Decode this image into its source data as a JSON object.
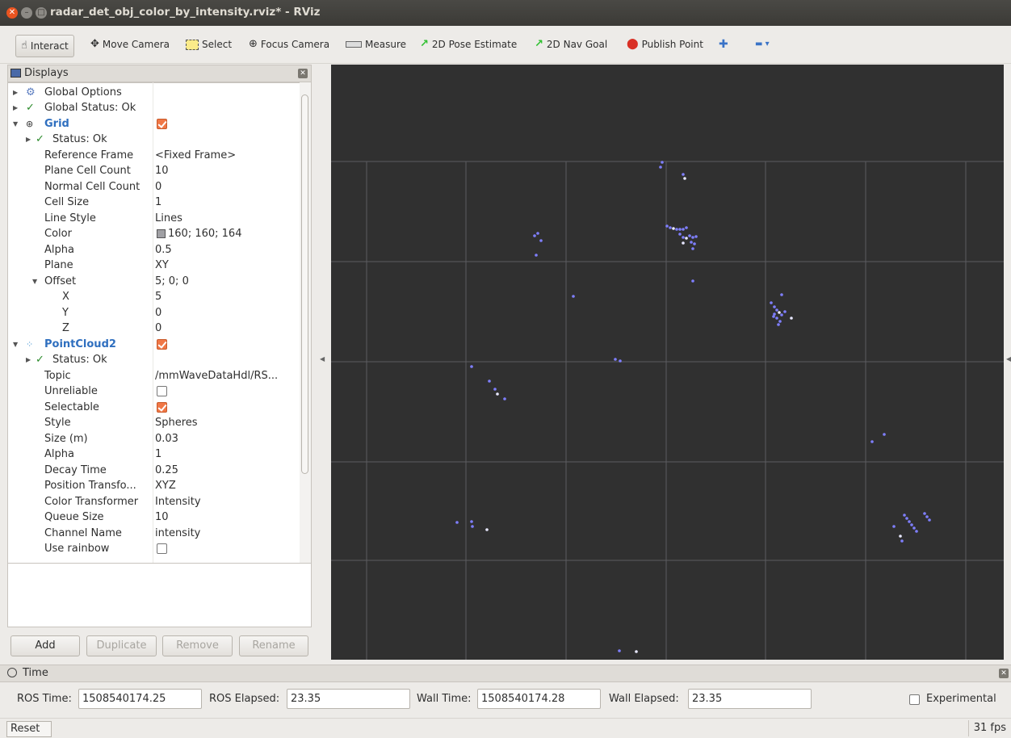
{
  "window": {
    "title": "radar_det_obj_color_by_intensity.rviz* - RViz",
    "close_glyph": "✕",
    "min_glyph": "–",
    "max_glyph": "□"
  },
  "toolbar": {
    "interact": "Interact",
    "move_camera": "Move Camera",
    "select": "Select",
    "focus_camera": "Focus Camera",
    "measure": "Measure",
    "pose_estimate": "2D Pose Estimate",
    "nav_goal": "2D Nav Goal",
    "publish_point": "Publish Point",
    "add_tool": "✚",
    "remove_tool": "▬ ▾"
  },
  "displays": {
    "title": "Displays",
    "close": "✕",
    "tree": [
      {
        "label": "Global Options",
        "value": ""
      },
      {
        "label": "Global Status: Ok",
        "value": ""
      },
      {
        "label": "Grid",
        "value": ""
      },
      {
        "label": "Status: Ok",
        "value": ""
      },
      {
        "label": "Reference Frame",
        "value": "<Fixed Frame>"
      },
      {
        "label": "Plane Cell Count",
        "value": "10"
      },
      {
        "label": "Normal Cell Count",
        "value": "0"
      },
      {
        "label": "Cell Size",
        "value": "1"
      },
      {
        "label": "Line Style",
        "value": "Lines"
      },
      {
        "label": "Color",
        "value": "160; 160; 164"
      },
      {
        "label": "Alpha",
        "value": "0.5"
      },
      {
        "label": "Plane",
        "value": "XY"
      },
      {
        "label": "Offset",
        "value": "5; 0; 0"
      },
      {
        "label": "X",
        "value": "5"
      },
      {
        "label": "Y",
        "value": "0"
      },
      {
        "label": "Z",
        "value": "0"
      },
      {
        "label": "PointCloud2",
        "value": ""
      },
      {
        "label": "Status: Ok",
        "value": ""
      },
      {
        "label": "Topic",
        "value": "/mmWaveDataHdl/RS..."
      },
      {
        "label": "Unreliable",
        "value": ""
      },
      {
        "label": "Selectable",
        "value": ""
      },
      {
        "label": "Style",
        "value": "Spheres"
      },
      {
        "label": "Size (m)",
        "value": "0.03"
      },
      {
        "label": "Alpha",
        "value": "1"
      },
      {
        "label": "Decay Time",
        "value": "0.25"
      },
      {
        "label": "Position Transfo...",
        "value": "XYZ"
      },
      {
        "label": "Color Transformer",
        "value": "Intensity"
      },
      {
        "label": "Queue Size",
        "value": "10"
      },
      {
        "label": "Channel Name",
        "value": "intensity"
      },
      {
        "label": "Use rainbow",
        "value": ""
      }
    ],
    "grid_color": "#a0a0a4",
    "buttons": {
      "add": "Add",
      "duplicate": "Duplicate",
      "remove": "Remove",
      "rename": "Rename"
    }
  },
  "time_panel": {
    "title": "Time",
    "close": "✕",
    "ros_time_label": "ROS Time:",
    "ros_time": "1508540174.25",
    "ros_elapsed_label": "ROS Elapsed:",
    "ros_elapsed": "23.35",
    "wall_time_label": "Wall Time:",
    "wall_time": "1508540174.28",
    "wall_elapsed_label": "Wall Elapsed:",
    "wall_elapsed": "23.35",
    "experimental": "Experimental"
  },
  "status": {
    "reset": "Reset",
    "fps": "31 fps"
  },
  "colors": {
    "viewport_bg": "#303030",
    "grid_line": "#5c5c60",
    "point_blue": "#7f7fff",
    "point_white": "#e8e8ff",
    "checkbox_orange": "#f07746"
  }
}
